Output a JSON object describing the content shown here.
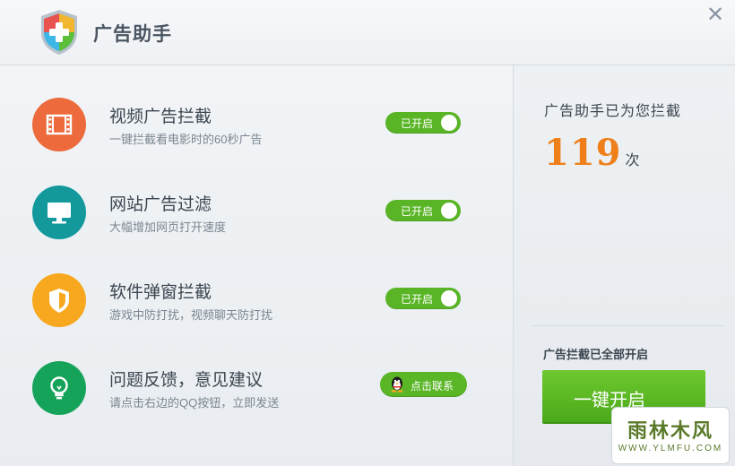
{
  "window": {
    "title": "广告助手",
    "close_glyph": "✕",
    "logo_icon": "shield-plus-icon"
  },
  "features": [
    {
      "title": "视频广告拦截",
      "description": "一键拦截看电影时的60秒广告",
      "icon": "film-icon",
      "icon_color": "#ec6a3b",
      "status_label": "已开启",
      "enabled": true
    },
    {
      "title": "网站广告过滤",
      "description": "大幅增加网页打开速度",
      "icon": "monitor-icon",
      "icon_color": "#13999c",
      "status_label": "已开启",
      "enabled": true
    },
    {
      "title": "软件弹窗拦截",
      "description": "游戏中防打扰，视频聊天防打扰",
      "icon": "shield-icon",
      "icon_color": "#f7a81e",
      "status_label": "已开启",
      "enabled": true
    },
    {
      "title": "问题反馈，意见建议",
      "description": "请点击右边的QQ按钮，立即发送",
      "icon": "lightbulb-icon",
      "icon_color": "#15a35a",
      "button_label": "点击联系",
      "button_icon": "qq-penguin-icon"
    }
  ],
  "stats": {
    "blocked_label": "广告助手已为您拦截",
    "count": "119",
    "unit": "次"
  },
  "summary": {
    "all_on_label": "广告拦截已全部开启",
    "one_click_label": "一键开启"
  },
  "watermark": {
    "title": "雨林木风",
    "url": "WWW.YLMFU.COM"
  },
  "colors": {
    "toggle_on": "#59b525",
    "count": "#ef7f1a",
    "primary_button": "#5cb822"
  }
}
